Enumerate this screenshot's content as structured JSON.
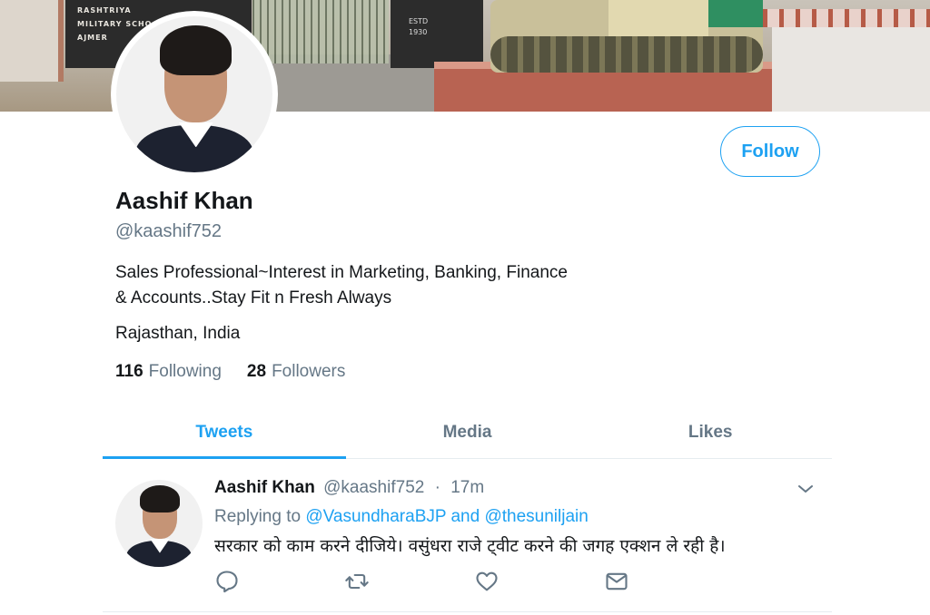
{
  "banner": {
    "sign_lines": [
      "RASHTRIYA",
      "MILITARY SCHO",
      "AJMER"
    ],
    "post_lines": [
      "ESTD",
      "1930"
    ]
  },
  "profile": {
    "name": "Aashif Khan",
    "handle": "@kaashif752",
    "bio_line1": "Sales Professional~Interest in Marketing, Banking, Finance",
    "bio_line2": "& Accounts..Stay Fit n Fresh Always",
    "location": "Rajasthan, India",
    "following_count": "116",
    "following_label": "Following",
    "followers_count": "28",
    "followers_label": "Followers"
  },
  "follow_button": {
    "label": "Follow"
  },
  "tabs": [
    {
      "label": "Tweets",
      "active": true
    },
    {
      "label": "Media",
      "active": false
    },
    {
      "label": "Likes",
      "active": false
    }
  ],
  "tweet": {
    "name": "Aashif Khan",
    "handle": "@kaashif752",
    "dot": "·",
    "time": "17m",
    "replying_prefix": "Replying to",
    "mention1": "@VasundharaBJP",
    "mention_joiner": "and",
    "mention2": "@thesuniljain",
    "text": "सरकार को काम करने दीजिये। वसुंधरा राजे ट्वीट करने की जगह एक्शन ले रही है।",
    "icons": [
      "reply-icon",
      "retweet-icon",
      "like-icon",
      "message-icon",
      "chevron-down-icon"
    ]
  },
  "colors": {
    "accent": "#1da1f2",
    "muted": "#657786",
    "text": "#14171a",
    "divider": "#e6ecf0"
  }
}
